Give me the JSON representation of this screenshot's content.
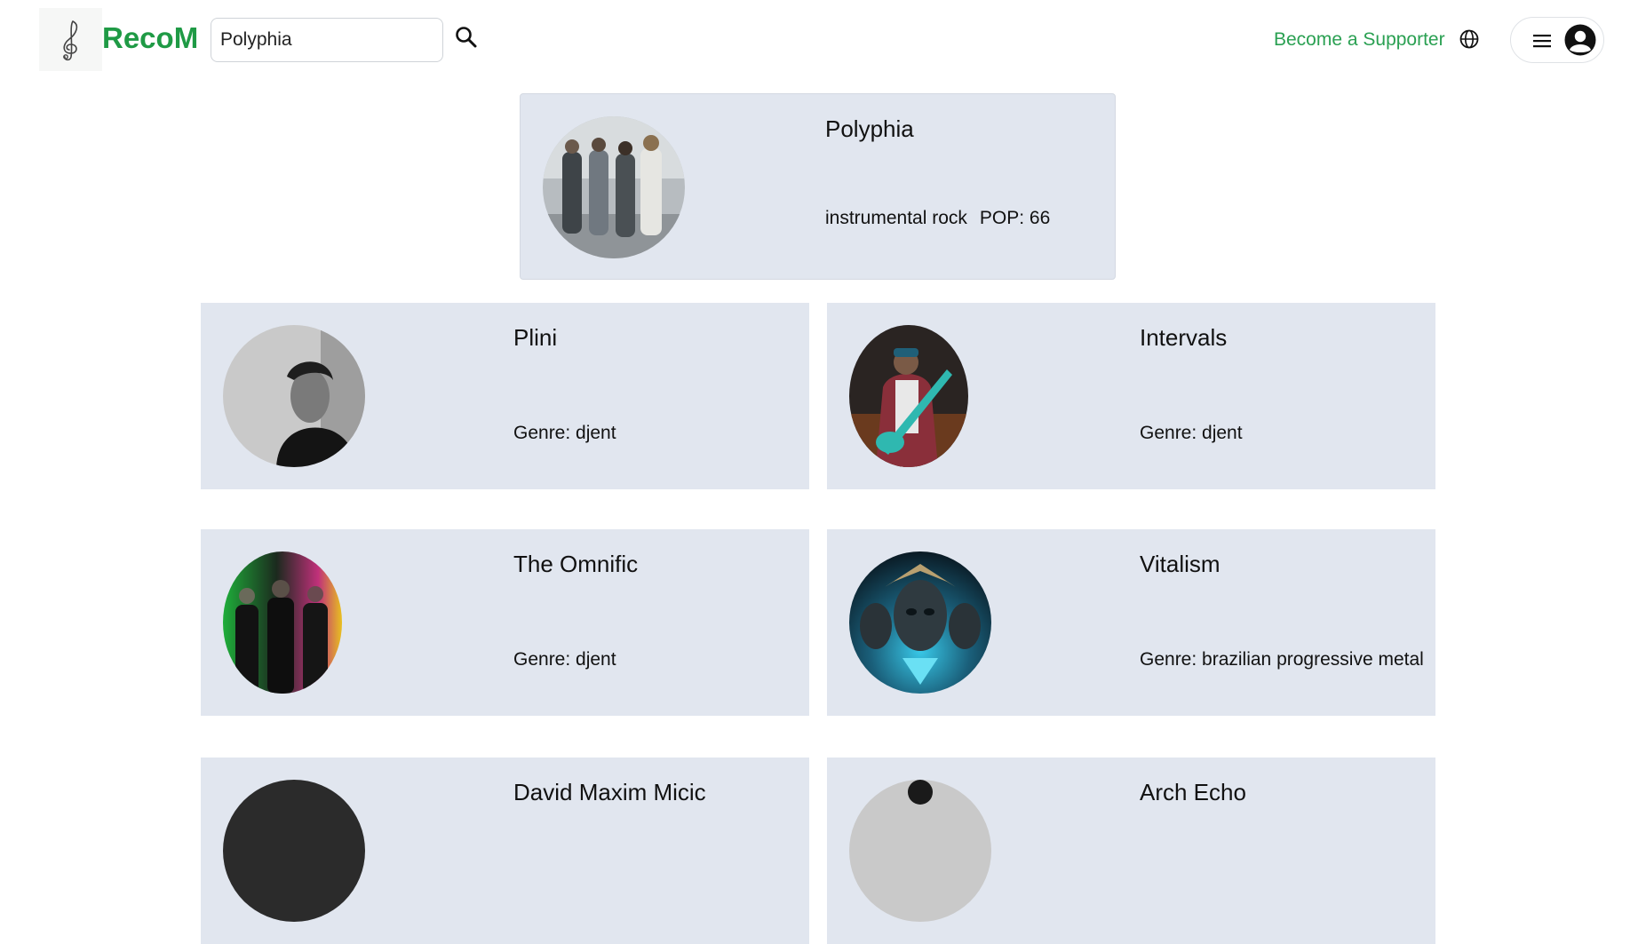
{
  "header": {
    "brand": "RecoM",
    "search_value": "Polyphia",
    "supporter_link": "Become a Supporter",
    "icons": [
      "treble-clef-logo-icon",
      "search-icon",
      "globe-icon",
      "menu-icon",
      "user-avatar-icon"
    ]
  },
  "featured": {
    "name": "Polyphia",
    "genre": "instrumental rock",
    "popularity": "POP: 66"
  },
  "recommendations": [
    {
      "name": "Plini",
      "genre": "Genre: djent"
    },
    {
      "name": "Intervals",
      "genre": "Genre: djent"
    },
    {
      "name": "The Omnific",
      "genre": "Genre: djent"
    },
    {
      "name": "Vitalism",
      "genre": "Genre: brazilian progressive metal"
    },
    {
      "name": "David Maxim Micic",
      "genre": ""
    },
    {
      "name": "Arch Echo",
      "genre": ""
    }
  ],
  "colors": {
    "brand_green": "#1f9a45",
    "link_green": "#2aa052",
    "card_bg": "#e1e6ef"
  }
}
